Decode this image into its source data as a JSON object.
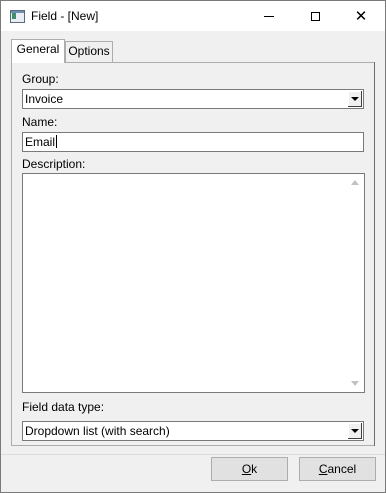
{
  "window": {
    "title": "Field - [New]",
    "icon": "form-field-icon",
    "minimize_icon": "minimize-icon",
    "maximize_icon": "maximize-icon",
    "close_glyph": "✕"
  },
  "tabs": [
    {
      "label": "General",
      "active": true
    },
    {
      "label": "Options",
      "active": false
    }
  ],
  "form": {
    "group": {
      "label": "Group:",
      "value": "Invoice"
    },
    "name": {
      "label": "Name:",
      "value": "Email"
    },
    "description": {
      "label": "Description:",
      "value": ""
    },
    "field_data_type": {
      "label": "Field data type:",
      "value": "Dropdown list (with search)"
    }
  },
  "buttons": {
    "ok": {
      "mnemonic": "O",
      "rest": "k"
    },
    "cancel": {
      "mnemonic": "C",
      "rest": "ancel"
    }
  }
}
